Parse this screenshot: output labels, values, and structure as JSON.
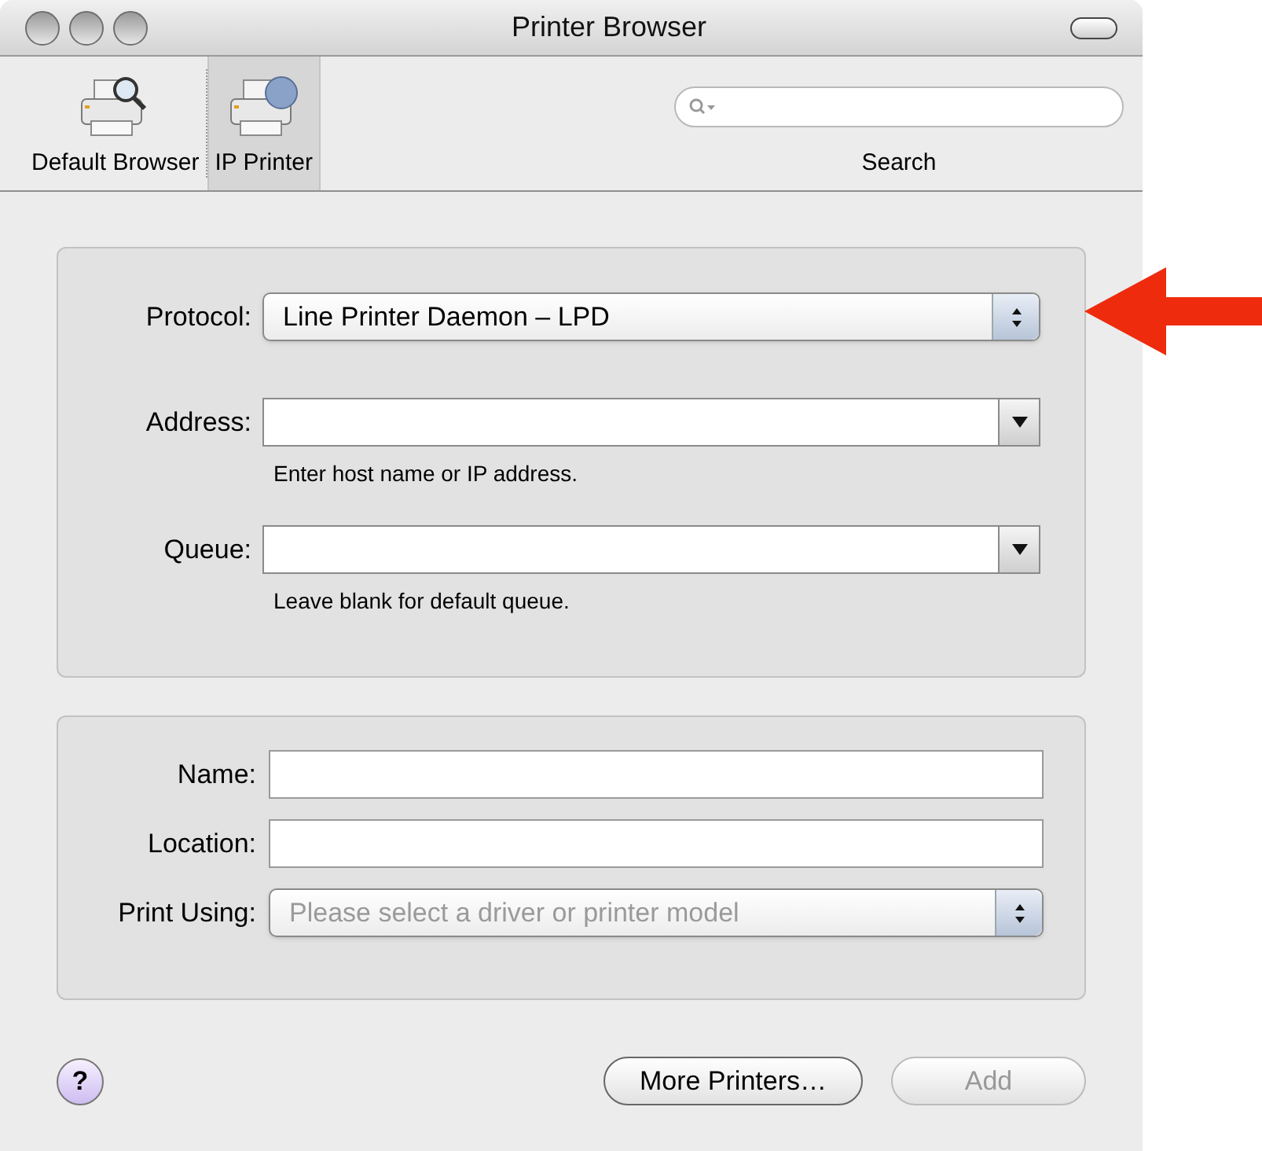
{
  "window": {
    "title": "Printer Browser"
  },
  "toolbar": {
    "items": [
      {
        "label": "Default Browser",
        "selected": false,
        "kind": "browse"
      },
      {
        "label": "IP Printer",
        "selected": true,
        "kind": "ip"
      }
    ],
    "search": {
      "label": "Search"
    }
  },
  "connection": [
    {
      "label": "Protocol:",
      "kind": "popup",
      "value": "Line Printer Daemon – LPD"
    },
    {
      "label": "Address:",
      "kind": "combo",
      "hint": "Enter host name or IP address."
    },
    {
      "label": "Queue:",
      "kind": "combo",
      "hint": "Leave blank for default queue."
    }
  ],
  "printer": [
    {
      "label": "Name:",
      "kind": "text"
    },
    {
      "label": "Location:",
      "kind": "text"
    },
    {
      "label": "Print Using:",
      "kind": "popup",
      "placeholder": "Please select a driver or printer model"
    }
  ],
  "help_button": "?",
  "buttons": [
    {
      "label": "More Printers…",
      "disabled": false
    },
    {
      "label": "Add",
      "disabled": true
    }
  ]
}
